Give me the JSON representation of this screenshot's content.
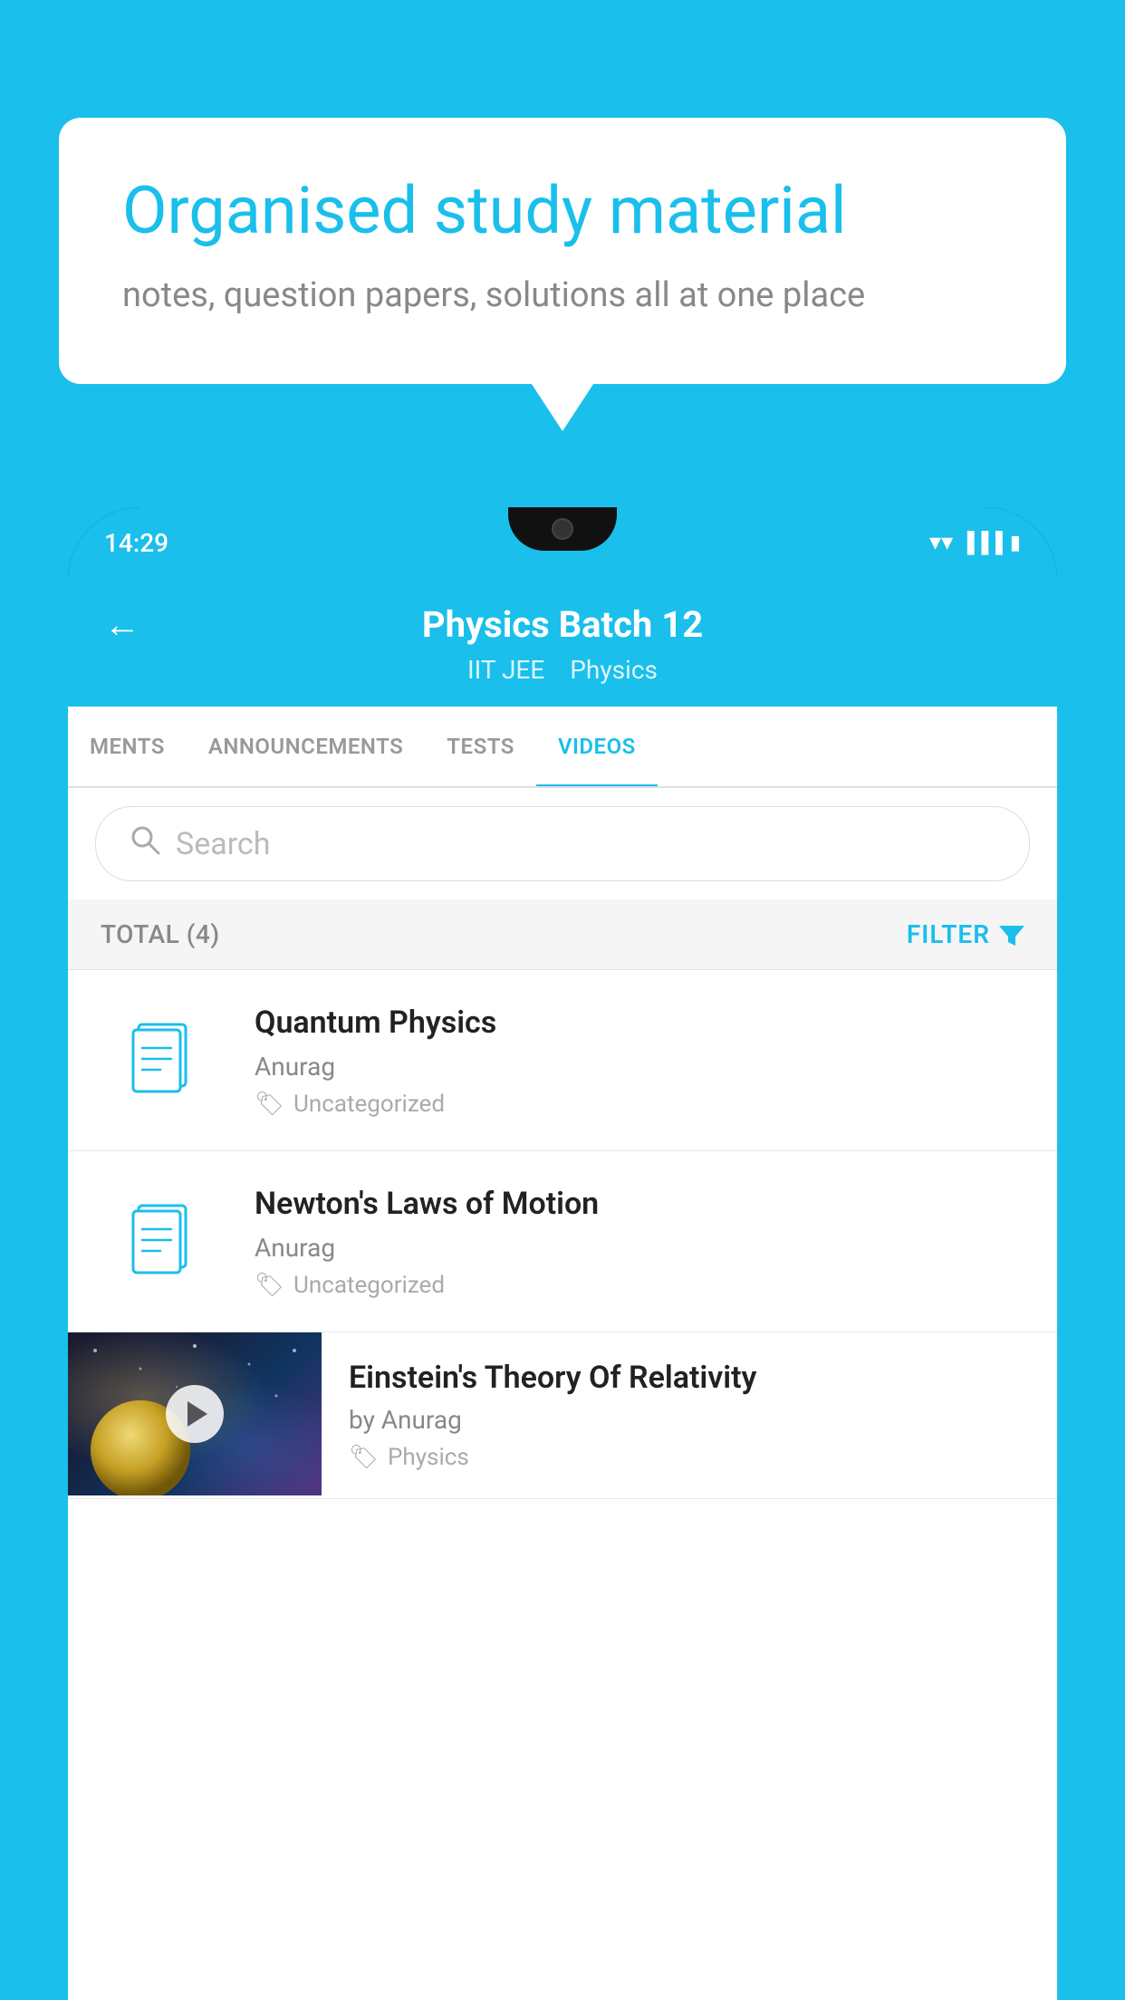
{
  "background_color": "#1ABFEB",
  "speech_bubble": {
    "heading": "Organised study material",
    "subtext": "notes, question papers, solutions all at one place"
  },
  "phone": {
    "status_bar": {
      "time": "14:29"
    },
    "header": {
      "back_label": "←",
      "title": "Physics Batch 12",
      "subtitle_1": "IIT JEE",
      "subtitle_2": "Physics"
    },
    "tabs": [
      {
        "label": "MENTS",
        "active": false
      },
      {
        "label": "ANNOUNCEMENTS",
        "active": false
      },
      {
        "label": "TESTS",
        "active": false
      },
      {
        "label": "VIDEOS",
        "active": true
      }
    ],
    "search": {
      "placeholder": "Search"
    },
    "filter_row": {
      "total_label": "TOTAL (4)",
      "filter_label": "FILTER"
    },
    "videos": [
      {
        "id": "quantum",
        "title": "Quantum Physics",
        "author": "Anurag",
        "tag": "Uncategorized",
        "has_thumb": false
      },
      {
        "id": "newton",
        "title": "Newton's Laws of Motion",
        "author": "Anurag",
        "tag": "Uncategorized",
        "has_thumb": false
      },
      {
        "id": "einstein",
        "title": "Einstein's Theory Of Relativity",
        "author": "by Anurag",
        "tag": "Physics",
        "has_thumb": true
      }
    ]
  }
}
